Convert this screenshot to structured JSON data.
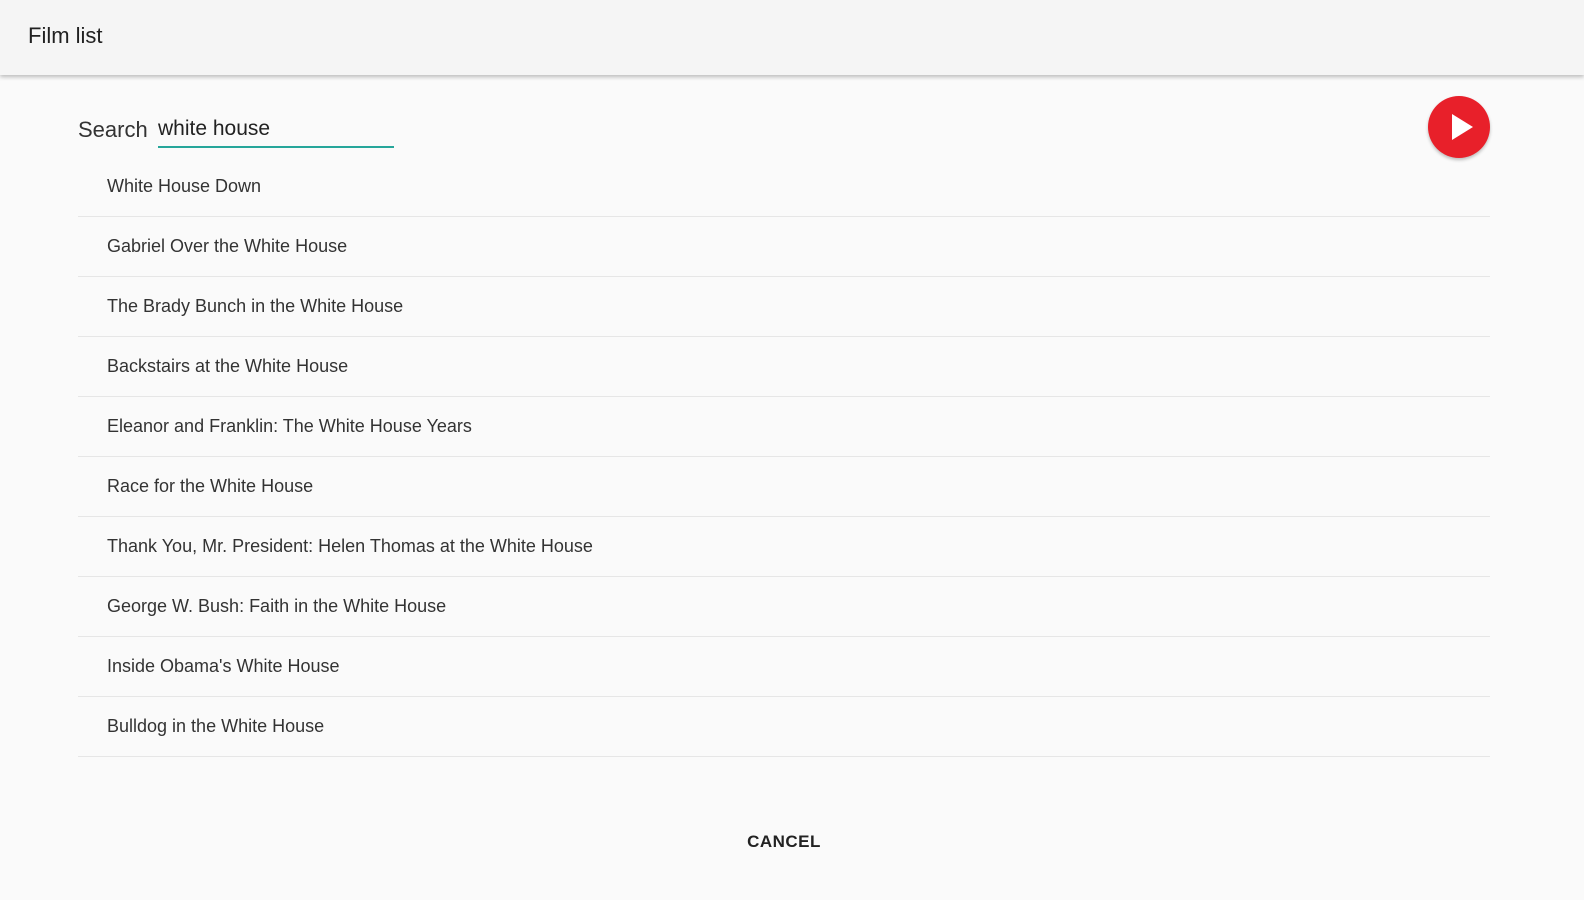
{
  "appbar": {
    "title": "Film list"
  },
  "search": {
    "label": "Search",
    "value": "white house"
  },
  "play_button": {
    "icon": "play-icon",
    "color": "#e8202a"
  },
  "films": [
    "White House Down",
    "Gabriel Over the White House",
    "The Brady Bunch in the White House",
    "Backstairs at the White House",
    "Eleanor and Franklin: The White House Years",
    "Race for the White House",
    "Thank You, Mr. President: Helen Thomas at the White House",
    "George W. Bush: Faith in the White House",
    "Inside Obama's White House",
    "Bulldog in the White House"
  ],
  "actions": {
    "cancel_label": "CANCEL"
  },
  "colors": {
    "accent": "#26a69a",
    "background": "#fafafa",
    "appbar": "#f5f5f5"
  }
}
